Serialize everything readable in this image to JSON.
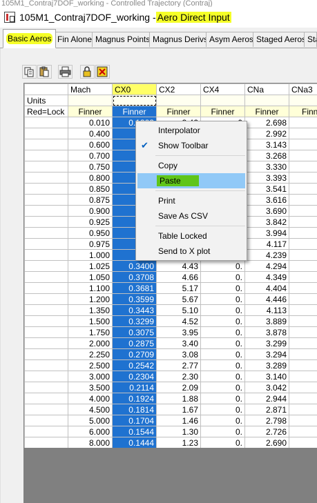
{
  "window": {
    "behind_title": "105M1_Contraj7DOF_working - Controlled Trajectory (Contraj)",
    "title": "105M1_Contraj7DOF_working - ",
    "title_highlight": "Aero Direct Input"
  },
  "tabs": [
    {
      "label": "Basic Aeros",
      "active": true
    },
    {
      "label": "Fin Alone"
    },
    {
      "label": "Magnus Points"
    },
    {
      "label": "Magnus Derivs"
    },
    {
      "label": "Asym Aeros"
    },
    {
      "label": "Staged Aeros"
    },
    {
      "label": "Sta"
    }
  ],
  "toolbar": {
    "icons": [
      "copy-icon",
      "paste-icon",
      "print-icon",
      "lock-icon",
      "clear-icon"
    ]
  },
  "grid": {
    "columns": [
      "Mach",
      "CX0",
      "CX2",
      "CX4",
      "CNa",
      "CNa3"
    ],
    "row_labels": {
      "units": "Units",
      "lock": "Red=Lock"
    },
    "source_row": [
      "Finner",
      "Finner",
      "Finner",
      "Finner",
      "Finner",
      "Finne"
    ],
    "rows": [
      {
        "mach": "0.010",
        "cx0": "0.1323",
        "cx2": "3.42",
        "cx4": "0",
        "cna": "2.698"
      },
      {
        "mach": "0.400",
        "cx0": "",
        "cx2": "",
        "cx4": "",
        "cna": "2.992"
      },
      {
        "mach": "0.600",
        "cx0": "",
        "cx2": "",
        "cx4": "",
        "cna": "3.143"
      },
      {
        "mach": "0.700",
        "cx0": "",
        "cx2": "",
        "cx4": "",
        "cna": "3.268"
      },
      {
        "mach": "0.750",
        "cx0": "",
        "cx2": "",
        "cx4": "",
        "cna": "3.330"
      },
      {
        "mach": "0.800",
        "cx0": "",
        "cx2": "",
        "cx4": "",
        "cna": "3.393"
      },
      {
        "mach": "0.850",
        "cx0": "",
        "cx2": "",
        "cx4": "",
        "cna": "3.541"
      },
      {
        "mach": "0.875",
        "cx0": "",
        "cx2": "",
        "cx4": "",
        "cna": "3.616"
      },
      {
        "mach": "0.900",
        "cx0": "",
        "cx2": "",
        "cx4": "",
        "cna": "3.690"
      },
      {
        "mach": "0.925",
        "cx0": "",
        "cx2": "",
        "cx4": "",
        "cna": "3.842"
      },
      {
        "mach": "0.950",
        "cx0": "",
        "cx2": "",
        "cx4": "",
        "cna": "3.994"
      },
      {
        "mach": "0.975",
        "cx0": "",
        "cx2": "",
        "cx4": "",
        "cna": "4.117"
      },
      {
        "mach": "1.000",
        "cx0": "",
        "cx2": "",
        "cx4": "",
        "cna": "4.239"
      },
      {
        "mach": "1.025",
        "cx0": "0.3400",
        "cx2": "4.43",
        "cx4": "0.",
        "cna": "4.294"
      },
      {
        "mach": "1.050",
        "cx0": "0.3708",
        "cx2": "4.66",
        "cx4": "0.",
        "cna": "4.349"
      },
      {
        "mach": "1.100",
        "cx0": "0.3681",
        "cx2": "5.17",
        "cx4": "0.",
        "cna": "4.404"
      },
      {
        "mach": "1.200",
        "cx0": "0.3599",
        "cx2": "5.67",
        "cx4": "0.",
        "cna": "4.446"
      },
      {
        "mach": "1.350",
        "cx0": "0.3443",
        "cx2": "5.10",
        "cx4": "0.",
        "cna": "4.113"
      },
      {
        "mach": "1.500",
        "cx0": "0.3299",
        "cx2": "4.52",
        "cx4": "0.",
        "cna": "3.889"
      },
      {
        "mach": "1.750",
        "cx0": "0.3075",
        "cx2": "3.95",
        "cx4": "0.",
        "cna": "3.878"
      },
      {
        "mach": "2.000",
        "cx0": "0.2875",
        "cx2": "3.40",
        "cx4": "0.",
        "cna": "3.299"
      },
      {
        "mach": "2.250",
        "cx0": "0.2709",
        "cx2": "3.08",
        "cx4": "0.",
        "cna": "3.294"
      },
      {
        "mach": "2.500",
        "cx0": "0.2542",
        "cx2": "2.77",
        "cx4": "0.",
        "cna": "3.289"
      },
      {
        "mach": "3.000",
        "cx0": "0.2304",
        "cx2": "2.30",
        "cx4": "0.",
        "cna": "3.140"
      },
      {
        "mach": "3.500",
        "cx0": "0.2114",
        "cx2": "2.09",
        "cx4": "0.",
        "cna": "3.042"
      },
      {
        "mach": "4.000",
        "cx0": "0.1924",
        "cx2": "1.88",
        "cx4": "0.",
        "cna": "2.944"
      },
      {
        "mach": "4.500",
        "cx0": "0.1814",
        "cx2": "1.67",
        "cx4": "0.",
        "cna": "2.871"
      },
      {
        "mach": "5.000",
        "cx0": "0.1704",
        "cx2": "1.46",
        "cx4": "0.",
        "cna": "2.798"
      },
      {
        "mach": "6.000",
        "cx0": "0.1544",
        "cx2": "1.30",
        "cx4": "0.",
        "cna": "2.726"
      },
      {
        "mach": "8.000",
        "cx0": "0.1444",
        "cx2": "1.23",
        "cx4": "0.",
        "cna": "2.690"
      }
    ]
  },
  "context_menu": {
    "items": [
      {
        "label": "Interpolator"
      },
      {
        "label": "Show Toolbar",
        "checked": true
      },
      {
        "sep": true
      },
      {
        "label": "Copy"
      },
      {
        "label": "Paste",
        "highlighted": true
      },
      {
        "sep": true
      },
      {
        "label": "Print"
      },
      {
        "label": "Save As CSV"
      },
      {
        "sep": true
      },
      {
        "label": "Table Locked"
      },
      {
        "label": "Send to X plot"
      }
    ]
  },
  "colors": {
    "selection": "#1f72d0",
    "highlight_yellow": "#f5ff28",
    "menu_hover": "#91c9f7",
    "paste_highlight": "#5fc51a"
  }
}
